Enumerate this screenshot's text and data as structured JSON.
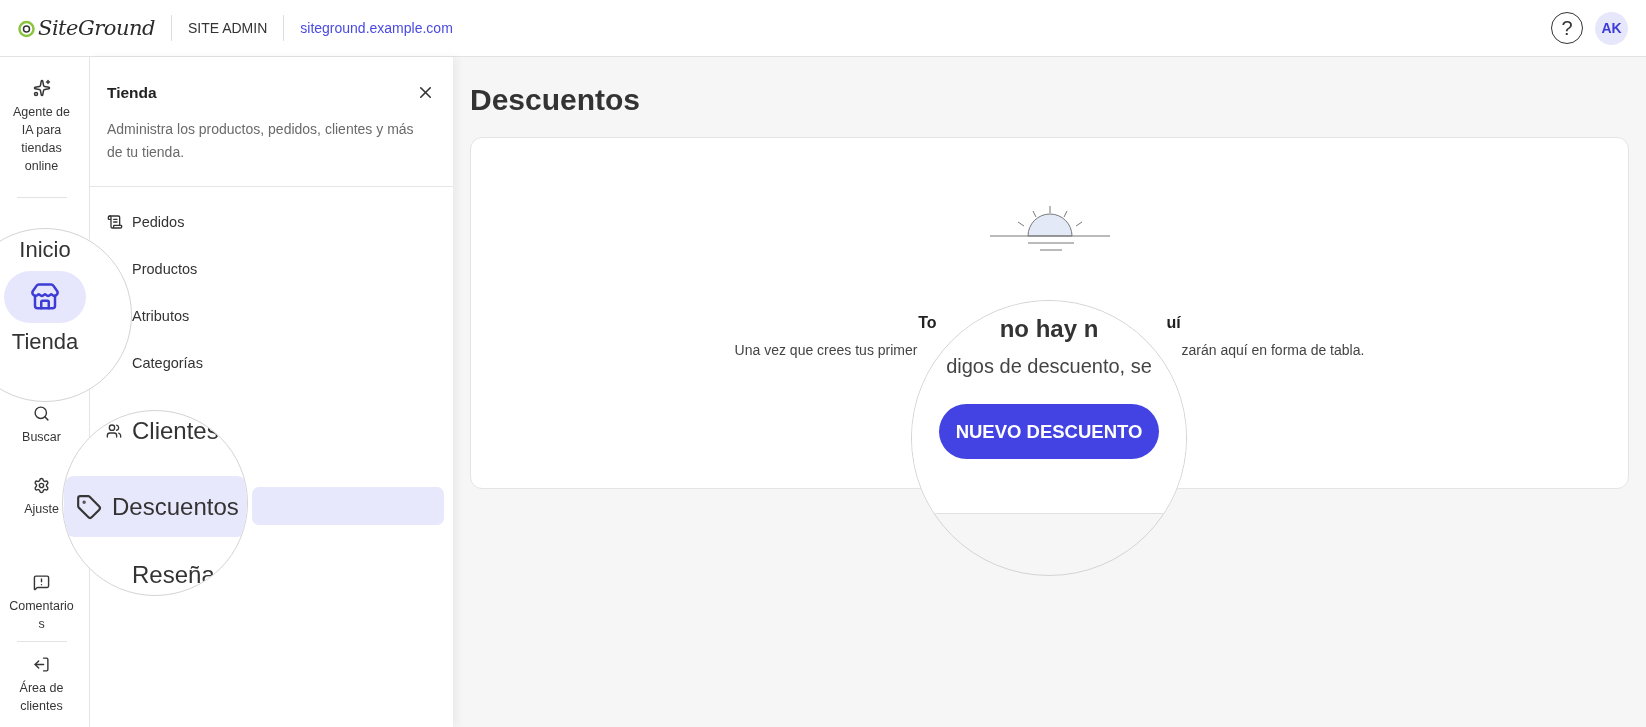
{
  "header": {
    "logo": "SiteGround",
    "section": "SITE ADMIN",
    "site_link": "siteground.example.com",
    "help": "?",
    "avatar": "AK"
  },
  "rail": {
    "top": {
      "kind": "ai",
      "label": "Agente de IA para tiendas online"
    },
    "items": [
      {
        "kind": "search",
        "label": "Buscar"
      },
      {
        "kind": "settings",
        "label": "Ajuste"
      },
      {
        "kind": "feedback",
        "label": "Comentarios"
      }
    ],
    "bottom": {
      "kind": "exit",
      "label": "Área de clientes"
    }
  },
  "rail_magnifier": {
    "items": [
      {
        "label": "Inicio",
        "selected": false
      },
      {
        "label": "Tienda",
        "selected": true
      }
    ]
  },
  "panel": {
    "title": "Tienda",
    "description": "Administra los productos, pedidos, clientes y más de tu tienda.",
    "items": [
      {
        "kind": "orders",
        "label": "Pedidos"
      },
      {
        "kind": "none",
        "label": "Productos"
      },
      {
        "kind": "none",
        "label": "Atributos"
      },
      {
        "kind": "none",
        "label": "Categorías"
      }
    ]
  },
  "panel_magnifier": {
    "items": [
      {
        "kind": "customers",
        "label": "Clientes",
        "selected": false
      },
      {
        "kind": "discounts",
        "label": "Descuentos",
        "selected": true
      },
      {
        "kind": "none",
        "label": "Reseña",
        "selected": false
      }
    ]
  },
  "page": {
    "title": "Descuentos",
    "subtitle_left": "To",
    "subtitle_right": "uí",
    "text_left": "Una vez que crees tus primer",
    "text_right": "zarán aquí en forma de tabla."
  },
  "card_magnifier": {
    "heading": "no hay n",
    "subtitle": "digos de descuento, se",
    "button": "NUEVO DESCUENTO"
  }
}
